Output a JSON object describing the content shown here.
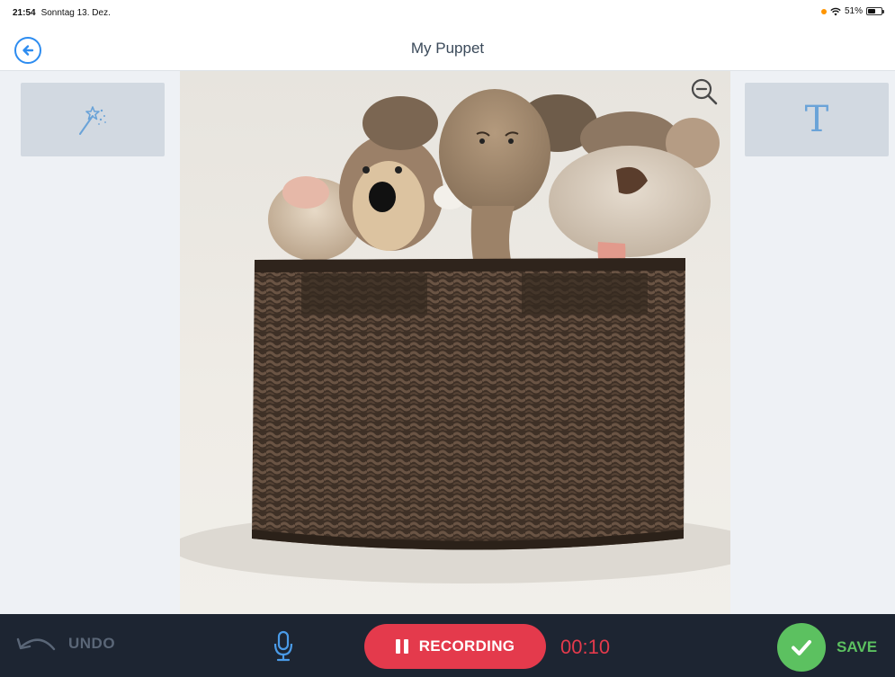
{
  "status": {
    "time": "21:54",
    "date": "Sonntag 13. Dez.",
    "battery": "51%"
  },
  "nav": {
    "title": "My Puppet"
  },
  "tools": {
    "text_tool_label": "T"
  },
  "bottom": {
    "undo_label": "UNDO",
    "recording_label": "RECORDING",
    "timer": "00:10",
    "save_label": "SAVE"
  },
  "colors": {
    "accent": "#2d8cf0",
    "recording": "#e43a4c",
    "save": "#5cc160",
    "toolbar": "#1d2532"
  },
  "icons": [
    "back-arrow-icon",
    "magic-wand-icon",
    "text-icon",
    "zoom-out-icon",
    "undo-icon",
    "microphone-icon",
    "pause-icon",
    "checkmark-icon"
  ]
}
